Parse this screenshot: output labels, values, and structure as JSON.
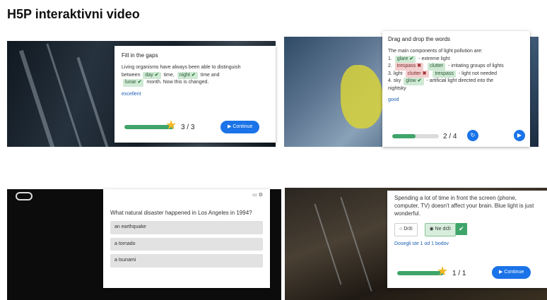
{
  "page_title": "H5P interaktivni video",
  "card1": {
    "heading": "Fill in the gaps",
    "text1": "Living organisms have always been able to distinguish",
    "text2": "between",
    "chip1": "day",
    "text3": "time,",
    "chip2": "night",
    "text4": "time and",
    "chip3": "lunar",
    "text5": "month. Now this is changed.",
    "feedback": "excellent",
    "progress": 1.0,
    "score": "3 / 3",
    "continue": "Continue"
  },
  "card2": {
    "heading": "Drag and drop the words",
    "intro": "The main components of light pollution are:",
    "l1_num": "1.",
    "l1_chip": "glare",
    "l1_text": "- extreme light",
    "l2_num": "2.",
    "l2_chip": "trespass",
    "l2_chip2": "clutter",
    "l2_text": "- irritating groups of lights",
    "l3_num": "3. light",
    "l3_chip": "clutter",
    "l3_chip2": "trespass",
    "l3_text": "- light not needed",
    "l4_num": "4. sky",
    "l4_chip": "glow",
    "l4_text": "- artificial light directed into the",
    "l4_text2": "nightsky",
    "feedback": "good",
    "progress": 0.5,
    "score": "2 / 4"
  },
  "card3": {
    "question": "What natural disaster happened in Los Angeles in 1994?",
    "opt1": "an earthquake",
    "opt2": "a tornado",
    "opt3": "a tsunami"
  },
  "card4": {
    "statement": "Spending a lot of time in front the screen (phone, computer, TV) doesn't affect your brain. Blue light is just wonderful.",
    "opt_true": "Drži",
    "opt_false": "Ne drži",
    "feedback": "Dosegli ste 1 od 1 bodov",
    "progress": 1.0,
    "score": "1 / 1",
    "continue": "Continue"
  },
  "icons": {
    "star": "star-icon",
    "play": "play-icon",
    "retry": "retry-icon"
  },
  "colors": {
    "accent": "#1a73e8",
    "correct": "#3fa56a",
    "wrong": "#a02b2b",
    "star": "#f2b824"
  }
}
